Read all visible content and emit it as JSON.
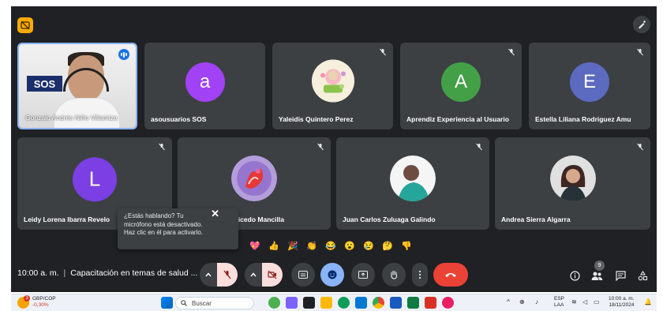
{
  "meeting": {
    "time": "10:00 a. m.",
    "title": "Capacitación en temas de salud ...",
    "participant_count": "9"
  },
  "participants_top": [
    {
      "name": "Gonzalo Andrés Niño Villamiza",
      "type": "video",
      "speaking": true
    },
    {
      "name": "asousuarios SOS",
      "initial": "a",
      "color": "#a142f4"
    },
    {
      "name": "Yaleidis Quintero Perez",
      "type": "photo"
    },
    {
      "name": "Aprendiz Experiencia al Usuario",
      "initial": "A",
      "color": "#43a047"
    },
    {
      "name": "Estella Liliana Rodriguez Amu",
      "initial": "E",
      "color": "#5c6bc0"
    }
  ],
  "participants_bottom": [
    {
      "name": "Leidy Lorena Ibarra Revelo",
      "initial": "L",
      "color": "#7b3fe4"
    },
    {
      "name": "María Victoria Caicedo Mancilla",
      "type": "photo"
    },
    {
      "name": "Juan Carlos Zuluaga Galindo",
      "type": "photo"
    },
    {
      "name": "Andrea Sierra Algarra",
      "type": "photo"
    }
  ],
  "tooltip": {
    "line1": "¿Estás hablando? Tu",
    "line2": "micrófono está desactivado.",
    "line3": "Haz clic en él para activarlo."
  },
  "reactions": [
    "💖",
    "👍",
    "🎉",
    "👏",
    "😂",
    "😮",
    "😢",
    "🤔",
    "👎"
  ],
  "taskbar": {
    "ticker_name": "GBP/COP",
    "ticker_change": "-0,30%",
    "weather_badge": "3",
    "search_placeholder": "Buscar",
    "lang_line1": "ESP",
    "lang_line2": "LAA",
    "clock_time": "10:00 a. m.",
    "clock_date": "18/11/2024"
  }
}
